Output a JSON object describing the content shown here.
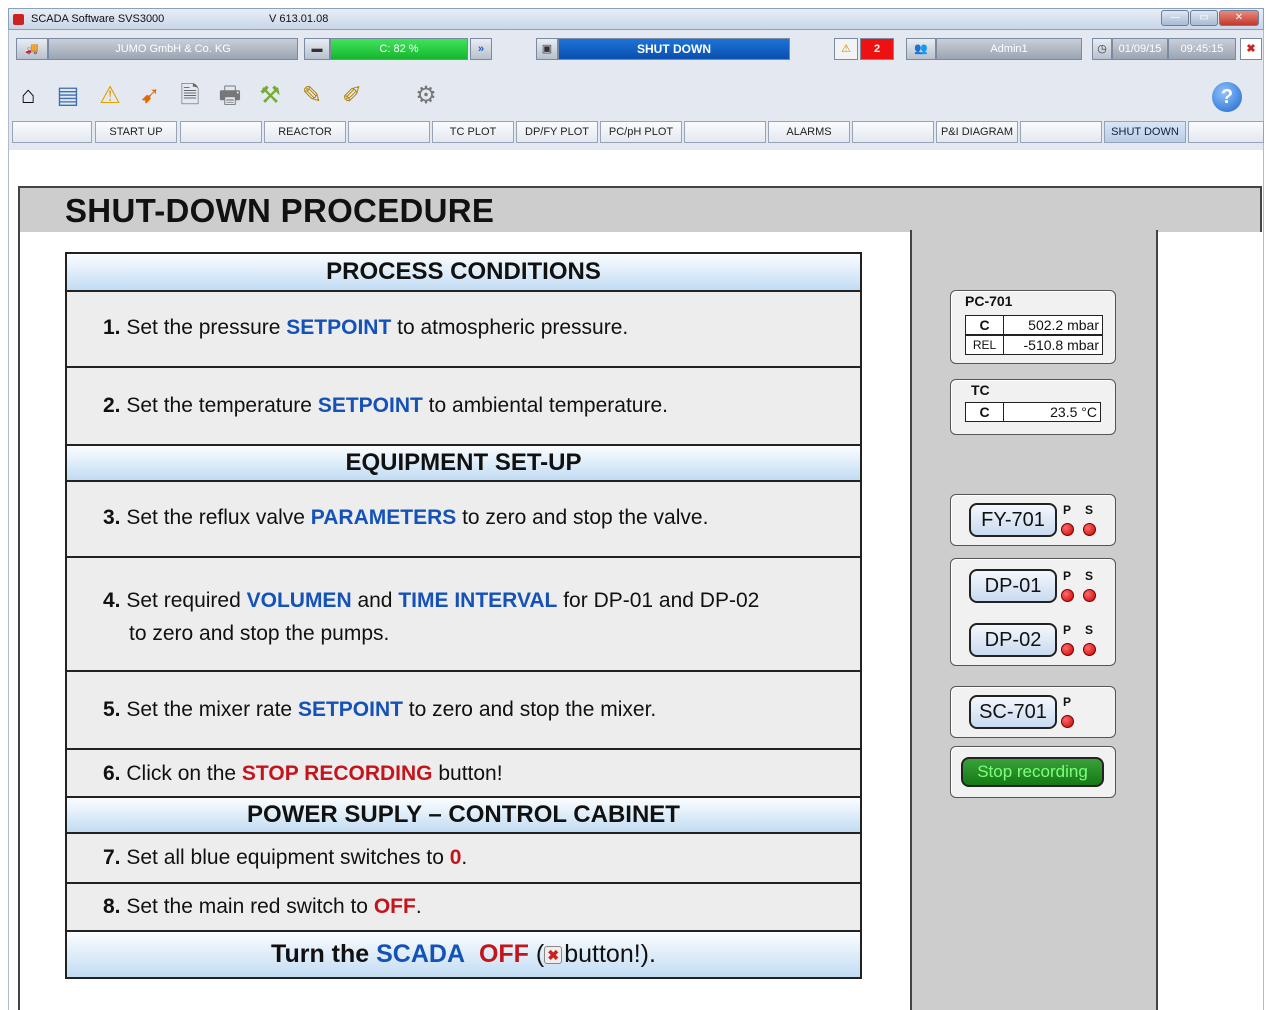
{
  "window": {
    "title": "SCADA Software  SVS3000",
    "version": "V 613.01.08",
    "min": "—",
    "max": "▭",
    "close": "✕"
  },
  "status": {
    "company": "JUMO GmbH & Co. KG",
    "capacity": "C: 82 %",
    "mode": "SHUT DOWN",
    "alarm_count": "2",
    "user": "Admin1",
    "date": "01/09/15",
    "time": "09:45:15"
  },
  "icons": {
    "app": "app-logo-icon",
    "truck": "device-icon",
    "forward": "forward-arrows-icon",
    "window": "window-icon",
    "warning": "warning-icon",
    "help": "help-icon"
  },
  "nav": [
    "START UP",
    "REACTOR",
    "TC PLOT",
    "DP/FY PLOT",
    "PC/pH PLOT",
    "ALARMS",
    "P&I DIAGRAM",
    "SHUT DOWN"
  ],
  "page_title": "SHUT-DOWN PROCEDURE",
  "sections": {
    "process": "PROCESS CONDITIONS",
    "equipment": "EQUIPMENT SET-UP",
    "power": "POWER SUPLY – CONTROL CABINET"
  },
  "steps": {
    "s1": {
      "n": "1.",
      "a": "Set the pressure ",
      "k": "SETPOINT",
      "b": " to atmospheric pressure."
    },
    "s2": {
      "n": "2.",
      "a": "Set the temperature ",
      "k": "SETPOINT",
      "b": " to ambiental temperature."
    },
    "s3": {
      "n": "3.",
      "a": "Set the reflux valve ",
      "k": "PARAMETERS",
      "b": " to zero and stop the valve."
    },
    "s4": {
      "n": "4.",
      "a": "Set required ",
      "k": "VOLUMEN",
      "m": " and ",
      "k2": "TIME INTERVAL",
      "b": " for DP-01 and DP-02",
      "c": "to zero and stop the pumps."
    },
    "s5": {
      "n": "5.",
      "a": "Set the mixer rate ",
      "k": "SETPOINT",
      "b": " to zero and stop the mixer."
    },
    "s6": {
      "n": "6.",
      "a": "Click on the ",
      "k": "STOP RECORDING",
      "b": "  button!"
    },
    "s7": {
      "n": "7.",
      "a": "Set all blue equipment switches to ",
      "k": "0",
      "b": "."
    },
    "s8": {
      "n": "8.",
      "a": "Set the main red switch to ",
      "k": "OFF",
      "b": "."
    },
    "final": {
      "a": "Turn the ",
      "k": "SCADA",
      "k2": "OFF",
      "b": " (",
      "btn": "✖",
      "c": "button!)."
    }
  },
  "pc701": {
    "title": "PC-701",
    "c_label": "C",
    "c_value": "502.2  mbar",
    "rel_label": "REL",
    "rel_value": "-510.8 mbar"
  },
  "tc": {
    "title": "TC",
    "c_label": "C",
    "c_value": "23.5     °C"
  },
  "devices": {
    "fy701": "FY-701",
    "dp01": "DP-01",
    "dp02": "DP-02",
    "sc701": "SC-701",
    "p": "P",
    "s": "S"
  },
  "stop_recording": "Stop recording"
}
